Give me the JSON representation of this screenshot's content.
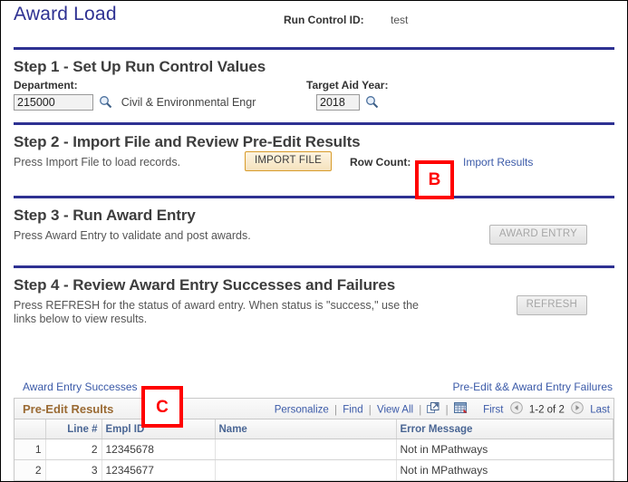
{
  "page": {
    "title": "Award Load",
    "run_control_label": "Run Control ID:",
    "run_control_value": "test",
    "accent_color": "#2e3192",
    "title_color": "#2e3192",
    "annotation_color": "#ff0000"
  },
  "step1": {
    "title": "Step 1 - Set Up Run Control Values",
    "department_label": "Department:",
    "department_value": "215000",
    "department_placeholder": "",
    "department_desc": "Civil & Environmental Engr",
    "aid_year_label": "Target Aid Year:",
    "aid_year_value": "2018",
    "aid_year_placeholder": "",
    "lookup_icon": "magnifier-icon"
  },
  "step2": {
    "title": "Step 2 - Import File and Review Pre-Edit Results",
    "instruction": "Press Import File to load records.",
    "import_button": "IMPORT FILE",
    "row_count_label": "Row Count:",
    "row_count_value": "",
    "import_results_link": "Import Results"
  },
  "step3": {
    "title": "Step 3 - Run Award Entry",
    "instruction": "Press Award Entry to validate and post awards.",
    "award_entry_button": "AWARD ENTRY",
    "award_entry_disabled": true
  },
  "step4": {
    "title": "Step 4 - Review Award Entry Successes and Failures",
    "instruction": "Press REFRESH for the status of award entry. When status is \"success,\" use the links below to view results.",
    "refresh_button": "REFRESH",
    "refresh_disabled": true
  },
  "results": {
    "successes_link": "Award Entry Successes",
    "failures_link": "Pre-Edit && Award Entry Failures",
    "grid_caption": "Pre-Edit Results",
    "tools": {
      "personalize": "Personalize",
      "find": "Find",
      "view_all": "View All",
      "zoom_icon": "expand-window-icon",
      "download_icon": "download-spreadsheet-icon"
    },
    "pager": {
      "first": "First",
      "prev_icon": "prev-arrow-icon",
      "count": "1-2 of 2",
      "next_icon": "next-arrow-icon",
      "last": "Last"
    },
    "columns": [
      "",
      "Line #",
      "Empl ID",
      "Name",
      "Error Message"
    ],
    "rows": [
      {
        "index": "1",
        "line": "2",
        "empl_id": "12345678",
        "name": "",
        "error": "Not in MPathways"
      },
      {
        "index": "2",
        "line": "3",
        "empl_id": "12345677",
        "name": "",
        "error": "Not in MPathways"
      }
    ]
  },
  "annotations": [
    {
      "label": "B"
    },
    {
      "label": "C"
    }
  ]
}
